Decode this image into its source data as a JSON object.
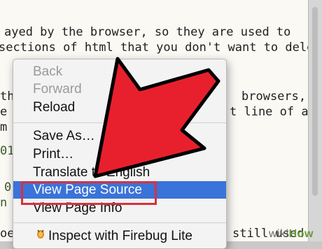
{
  "background_text": [
    "ayed by the browser, so they are used to",
    "sections of html that you don't want to delete",
    "th",
    "browsers,",
    "e I",
    "t line of a",
    "m",
    "01",
    "0",
    "n",
    "oe",
    "still used"
  ],
  "menu": {
    "back": "Back",
    "forward": "Forward",
    "reload": "Reload",
    "save_as": "Save As…",
    "print": "Print…",
    "translate": "Translate to English",
    "view_page_source": "View Page Source",
    "view_page_info": "View Page Info",
    "inspect_firebug": "Inspect with Firebug Lite"
  },
  "watermark": {
    "prefix": "wiki",
    "suffix": "How"
  },
  "colors": {
    "highlight": "#3a73d9",
    "annotation_red": "#d9313d"
  }
}
